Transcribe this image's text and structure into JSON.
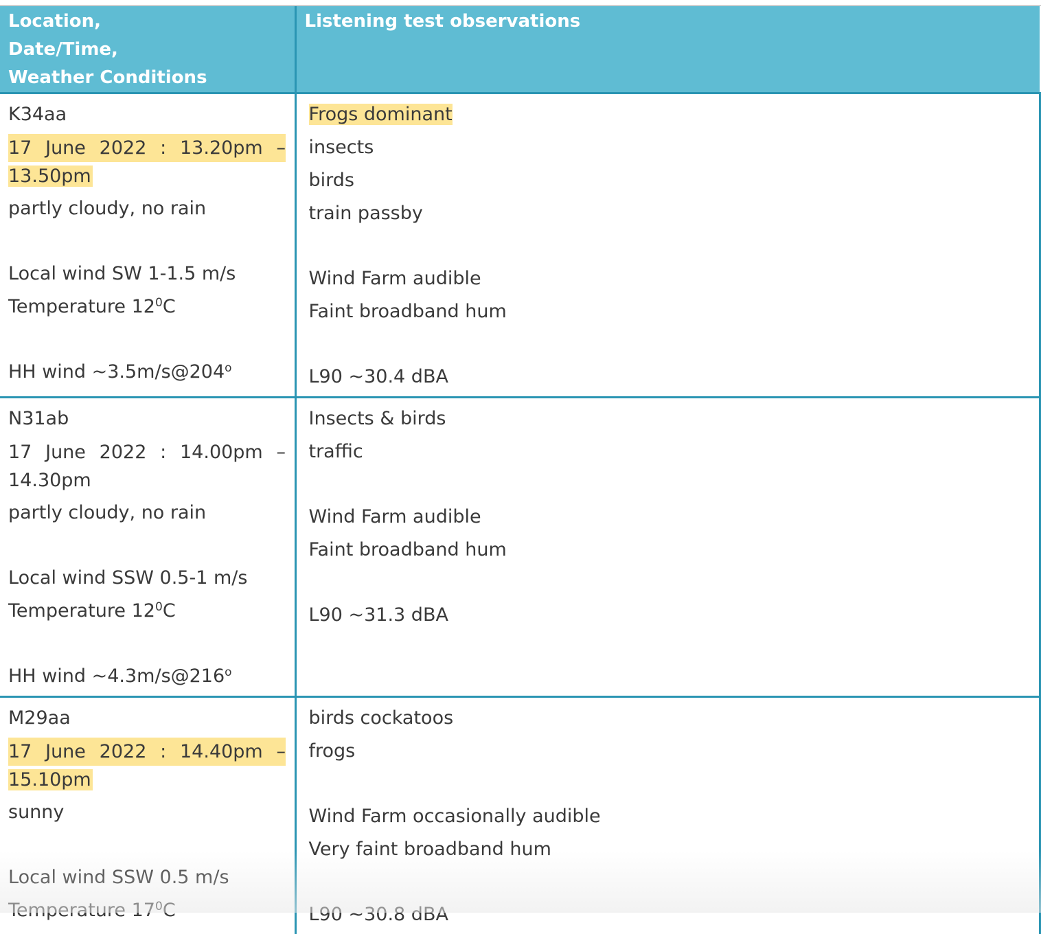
{
  "header": {
    "col1_line1": "Location,",
    "col1_line2": "Date/Time,",
    "col1_line3": "Weather Conditions",
    "col2": "Listening test observations"
  },
  "rows": [
    {
      "location": "K34aa",
      "date_parts": [
        "17",
        "June",
        "2022",
        ":",
        "13.20pm",
        "–"
      ],
      "date_end": "13.50pm",
      "date_highlighted": true,
      "weather": "partly cloudy, no rain",
      "local_wind": "Local wind SW 1-1.5 m/s",
      "temperature_value": "Temperature 12",
      "temperature_sup": "0",
      "temperature_unit": "C",
      "hh_wind_value": "HH wind ~3.5m/s@204",
      "hh_wind_sup": "o",
      "observations": {
        "o1": "Frogs dominant",
        "o2": "insects",
        "o3": "birds",
        "o4": "train passby",
        "o5": "Wind Farm audible",
        "o6": "Faint broadband hum",
        "o7": "L90 ~30.4 dBA"
      }
    },
    {
      "location": "N31ab",
      "date_parts": [
        "17",
        "June",
        "2022",
        ":",
        "14.00pm",
        "–"
      ],
      "date_end": "14.30pm",
      "date_highlighted": false,
      "weather": "partly cloudy, no rain",
      "local_wind": "Local wind SSW 0.5-1 m/s",
      "temperature_value": "Temperature 12",
      "temperature_sup": "0",
      "temperature_unit": "C",
      "hh_wind_value": "HH wind ~4.3m/s@216",
      "hh_wind_sup": "o",
      "observations": {
        "o1": "Insects & birds",
        "o2": "traffic",
        "o3": "Wind Farm audible",
        "o4": "Faint broadband hum",
        "o5": "L90 ~31.3 dBA"
      }
    },
    {
      "location": "M29aa",
      "date_parts": [
        "17",
        "June",
        "2022",
        ":",
        "14.40pm",
        "–"
      ],
      "date_end": "15.10pm",
      "date_highlighted": true,
      "weather": "sunny",
      "local_wind": "Local wind SSW 0.5 m/s",
      "temperature_value": "Temperature 17",
      "temperature_sup": "0",
      "temperature_unit": "C",
      "observations": {
        "o1": "birds cockatoos",
        "o2": "frogs",
        "o3": "Wind Farm occasionally audible",
        "o4": "Very faint broadband hum",
        "o5": "L90 ~30.8 dBA"
      }
    }
  ],
  "colors": {
    "header_bg": "#5fbcd3",
    "border": "#2b95b3",
    "highlight": "#fde596",
    "text": "#3a3a3a"
  }
}
